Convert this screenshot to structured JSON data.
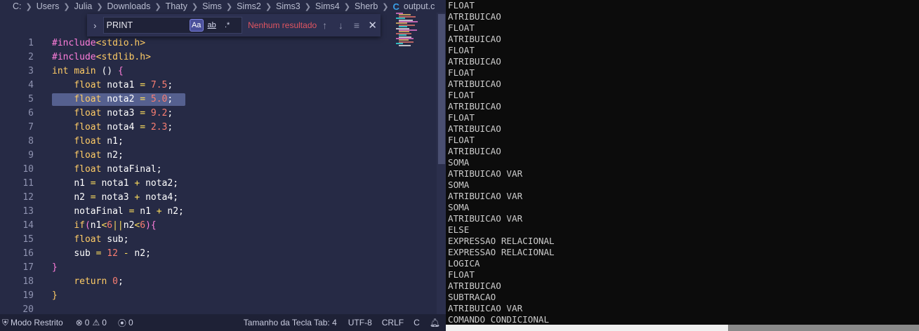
{
  "breadcrumb": {
    "items": [
      "C:",
      "Users",
      "Julia",
      "Downloads",
      "Thaty",
      "Sims",
      "Sims2",
      "Sims3",
      "Sims4",
      "Sherb"
    ],
    "file_icon": "C",
    "file_name": "output.c"
  },
  "find": {
    "value": "PRINT",
    "match_case_label": "Aa",
    "whole_word_label": "ab",
    "regex_label": ".*",
    "result_text": "Nenhum resultado",
    "prev_icon": "arrow-up-icon",
    "next_icon": "arrow-down-icon",
    "selection_icon": "find-in-selection-icon",
    "close_icon": "close-icon"
  },
  "code": {
    "line_numbers": [
      "1",
      "2",
      "3",
      "4",
      "5",
      "6",
      "7",
      "8",
      "9",
      "10",
      "11",
      "12",
      "13",
      "14",
      "15",
      "16",
      "17",
      "18",
      "19",
      "20"
    ],
    "highlighted_line": 5
  },
  "statusbar": {
    "restricted_mode": "Modo Restrito",
    "errors": "0",
    "warnings": "0",
    "ports": "0",
    "tab_size": "Tamanho da Tecla Tab: 4",
    "encoding": "UTF-8",
    "eol": "CRLF",
    "language": "C"
  },
  "terminal": {
    "lines": [
      "FLOAT",
      "ATRIBUICAO",
      "FLOAT",
      "ATRIBUICAO",
      "FLOAT",
      "ATRIBUICAO",
      "FLOAT",
      "ATRIBUICAO",
      "FLOAT",
      "ATRIBUICAO",
      "FLOAT",
      "ATRIBUICAO",
      "FLOAT",
      "ATRIBUICAO",
      "SOMA",
      "ATRIBUICAO VAR",
      "SOMA",
      "ATRIBUICAO VAR",
      "SOMA",
      "ATRIBUICAO VAR",
      "ELSE",
      "EXPRESSAO RELACIONAL",
      "EXPRESSAO RELACIONAL",
      "LOGICA",
      "FLOAT",
      "ATRIBUICAO",
      "SUBTRACAO",
      "ATRIBUICAO VAR",
      "COMANDO CONDICIONAL"
    ]
  },
  "colors": {
    "editor_bg": "#262a45",
    "terminal_bg": "#0c0c0c",
    "keyword": "#ffcc66",
    "number": "#f97e72",
    "preprocessor": "#ff7edb",
    "no_result": "#e05561"
  }
}
